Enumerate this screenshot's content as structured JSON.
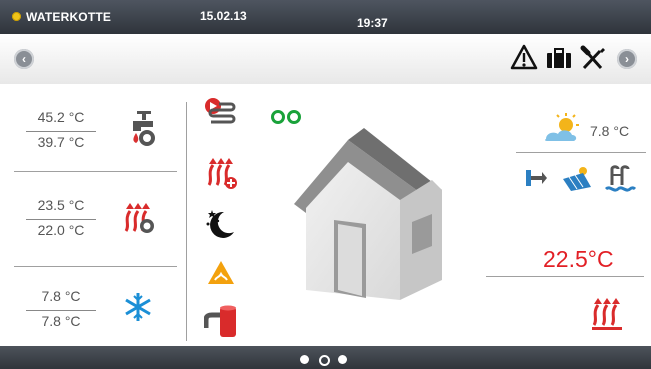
{
  "header": {
    "brand": "WATERKOTTE",
    "date": "15.02.13",
    "time": "19:37"
  },
  "toolbar": {
    "icons": [
      "back-arrow-icon",
      "warning-icon",
      "briefcase-icon",
      "tools-icon",
      "forward-arrow-icon"
    ]
  },
  "left_panel": {
    "hot_water": {
      "top": "45.2 °C",
      "bottom": "39.7 °C"
    },
    "heating": {
      "top": "23.5 °C",
      "bottom": "22.0 °C"
    },
    "cooling": {
      "top": "7.8 °C",
      "bottom": "7.8 °C"
    }
  },
  "status": {
    "green_indicators": 2
  },
  "right_panel": {
    "outside_temp": "7.8 °C",
    "room_temp": "22.5°C"
  },
  "pager": {
    "pages": 3,
    "current": 2
  },
  "colors": {
    "accent_red": "#e21f25",
    "status_green": "#1aa23a",
    "topbar": "#3a3f46"
  }
}
